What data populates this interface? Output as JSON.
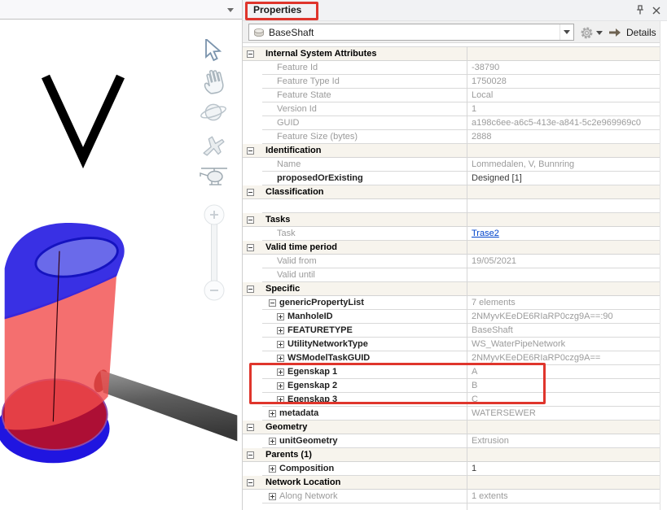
{
  "viewport": {
    "axis_label": "V",
    "top_strip": {
      "dropdown_icon": "caret-down"
    },
    "nav_tools": [
      {
        "name": "select-cursor",
        "icon": "cursor-icon"
      },
      {
        "name": "pan",
        "icon": "hand-icon"
      },
      {
        "name": "orbit",
        "icon": "planet-icon"
      },
      {
        "name": "fly",
        "icon": "plane-icon"
      },
      {
        "name": "helicopter-view",
        "icon": "helicopter-icon"
      },
      {
        "name": "zoom-slider",
        "icon": "slider-icon",
        "zoom_in_glyph": "+",
        "zoom_out_glyph": "−"
      }
    ],
    "model": {
      "description": "manhole shaft with bottom ring and pipe",
      "top_color": "#2a20e2",
      "body_color": "#f14b4b",
      "base_color": "#ad0f35",
      "ring_color": "#2015e0",
      "pipe_color": "#4a4a4a"
    }
  },
  "panel": {
    "title": "Properties",
    "pin_icon": "pin-icon",
    "close_icon": "close-x-icon",
    "combo": {
      "value": "BaseShaft",
      "icon": "feature-puck-icon",
      "dropdown_icon": "caret-down"
    },
    "gear_icon": "gear-icon",
    "details": {
      "label": "Details",
      "arrow_icon": "arrow-right-icon",
      "dropdown_icon": "caret-down"
    }
  },
  "annotations": {
    "color": "#df352c",
    "boxes": [
      "properties-title",
      "egenskap-rows"
    ]
  },
  "property_grid": {
    "rows": [
      {
        "type": "section",
        "expander": "minus",
        "label": "Internal System Attributes",
        "value": ""
      },
      {
        "type": "item",
        "indent": 1,
        "label": "Feature Id",
        "value": "-38790"
      },
      {
        "type": "item",
        "indent": 1,
        "label": "Feature Type Id",
        "value": "1750028"
      },
      {
        "type": "item",
        "indent": 1,
        "label": "Feature State",
        "value": "Local"
      },
      {
        "type": "item",
        "indent": 1,
        "label": "Version Id",
        "value": "1"
      },
      {
        "type": "item",
        "indent": 1,
        "label": "GUID",
        "value": "a198c6ee-a6c5-413e-a841-5c2e969969c0"
      },
      {
        "type": "item",
        "indent": 1,
        "label": "Feature Size (bytes)",
        "value": "2888"
      },
      {
        "type": "section",
        "expander": "minus",
        "label": "Identification",
        "value": ""
      },
      {
        "type": "item",
        "indent": 1,
        "label": "Name",
        "value": "Lommedalen, V, Bunnring"
      },
      {
        "type": "item",
        "indent": 1,
        "label": "proposedOrExisting",
        "label_style": "bold",
        "value": "Designed [1]",
        "value_style": "dark"
      },
      {
        "type": "section",
        "expander": "minus",
        "label": "Classification",
        "value": ""
      },
      {
        "type": "empty"
      },
      {
        "type": "section",
        "expander": "minus",
        "label": "Tasks",
        "value": ""
      },
      {
        "type": "item",
        "indent": 1,
        "label": "Task",
        "value": "Trase2",
        "value_style": "link"
      },
      {
        "type": "section",
        "expander": "minus",
        "label": "Valid time period",
        "value": ""
      },
      {
        "type": "item",
        "indent": 1,
        "label": "Valid from",
        "value": "19/05/2021"
      },
      {
        "type": "item",
        "indent": 1,
        "label": "Valid until",
        "value": ""
      },
      {
        "type": "section",
        "expander": "minus",
        "label": "Specific",
        "value": ""
      },
      {
        "type": "item",
        "indent": 1,
        "expander": "minus",
        "label": "genericPropertyList",
        "label_style": "bold",
        "value": "7 elements"
      },
      {
        "type": "item",
        "indent": 2,
        "expander": "plus",
        "label": "ManholeID",
        "label_style": "bold",
        "value": "2NMyvKEeDE6RIaRP0czg9A==:90"
      },
      {
        "type": "item",
        "indent": 2,
        "expander": "plus",
        "label": "FEATURETYPE",
        "label_style": "bold",
        "value": "BaseShaft"
      },
      {
        "type": "item",
        "indent": 2,
        "expander": "plus",
        "label": "UtilityNetworkType",
        "label_style": "bold",
        "value": "WS_WaterPipeNetwork"
      },
      {
        "type": "item",
        "indent": 2,
        "expander": "plus",
        "label": "WSModelTaskGUID",
        "label_style": "bold",
        "value": "2NMyvKEeDE6RIaRP0czg9A=="
      },
      {
        "type": "item",
        "indent": 2,
        "expander": "plus",
        "label": "Egenskap 1",
        "label_style": "bold",
        "value": "A"
      },
      {
        "type": "item",
        "indent": 2,
        "expander": "plus",
        "label": "Egenskap 2",
        "label_style": "bold",
        "value": "B"
      },
      {
        "type": "item",
        "indent": 2,
        "expander": "plus",
        "label": "Egenskap 3",
        "label_style": "bold",
        "value": "C"
      },
      {
        "type": "item",
        "indent": 1,
        "expander": "plus",
        "label": "metadata",
        "label_style": "bold",
        "value": "WATERSEWER"
      },
      {
        "type": "section",
        "expander": "minus",
        "label": "Geometry",
        "value": ""
      },
      {
        "type": "item",
        "indent": 1,
        "expander": "plus",
        "label": "unitGeometry",
        "label_style": "bold",
        "value": "Extrusion"
      },
      {
        "type": "section",
        "expander": "minus",
        "label": "Parents (1)",
        "value": ""
      },
      {
        "type": "item",
        "indent": 1,
        "expander": "plus",
        "label": "Composition",
        "label_style": "bold",
        "value": "1",
        "value_style": "dark"
      },
      {
        "type": "section",
        "expander": "minus",
        "label": "Network Location",
        "value": ""
      },
      {
        "type": "item",
        "indent": 1,
        "expander": "plus",
        "label": "Along Network",
        "value": "1 extents"
      }
    ]
  }
}
